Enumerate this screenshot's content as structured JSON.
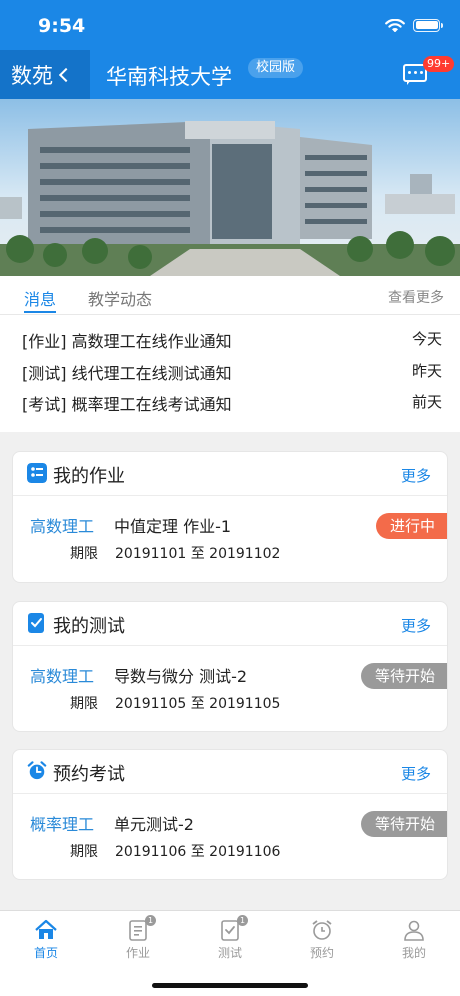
{
  "status_bar": {
    "time": "9:54"
  },
  "header": {
    "back_label": "数苑",
    "title": "华南科技大学",
    "campus_badge": "校园版",
    "message_count": "99+"
  },
  "news": {
    "tabs": [
      {
        "label": "消息",
        "active": true
      },
      {
        "label": "教学动态",
        "active": false
      }
    ],
    "view_more": "查看更多",
    "items": [
      {
        "text": "[作业] 高数理工在线作业通知",
        "date": "今天"
      },
      {
        "text": "[测试] 线代理工在线测试通知",
        "date": "昨天"
      },
      {
        "text": "[考试] 概率理工在线考试通知",
        "date": "前天"
      }
    ]
  },
  "cards": [
    {
      "title": "我的作业",
      "icon": "homework-icon",
      "more": "更多",
      "course": "高数理工",
      "task": "中值定理 作业-1",
      "period_label": "期限",
      "period": "20191101 至 20191102",
      "status": "进行中"
    },
    {
      "title": "我的测试",
      "icon": "test-icon",
      "more": "更多",
      "course": "高数理工",
      "task": "导数与微分 测试-2",
      "period_label": "期限",
      "period": "20191105 至 20191105",
      "status": "等待开始"
    },
    {
      "title": "预约考试",
      "icon": "alarm-clock-icon",
      "more": "更多",
      "course": "概率理工",
      "task": "单元测试-2",
      "period_label": "期限",
      "period": "20191106 至 20191106",
      "status": "等待开始"
    }
  ],
  "tabbar": {
    "items": [
      {
        "label": "首页",
        "icon": "home-icon",
        "active": true
      },
      {
        "label": "作业",
        "icon": "homework-icon",
        "badge": "1"
      },
      {
        "label": "测试",
        "icon": "test-icon",
        "badge": "1"
      },
      {
        "label": "预约",
        "icon": "alarm-clock-icon"
      },
      {
        "label": "我的",
        "icon": "profile-icon"
      }
    ]
  },
  "colors": {
    "primary": "#1b87e6",
    "primary_dark": "#1473c9",
    "status_in_progress": "#f36b4a",
    "status_waiting": "#9a9a9a",
    "badge_red": "#ff3b30"
  }
}
